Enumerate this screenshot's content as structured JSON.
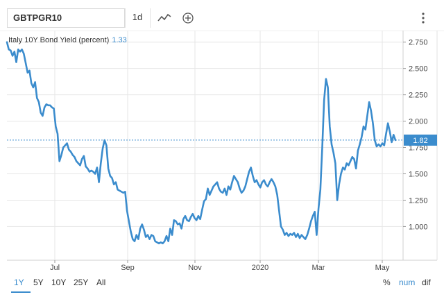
{
  "toolbar": {
    "symbol": "GBTPGR10",
    "interval": "1d",
    "chart_type_icon": "line-chart-icon",
    "compare_icon": "plus-circle-icon",
    "menu_icon": "vertical-dots-icon"
  },
  "series_label": {
    "name": "Italy 10Y Bond Yield (percent)",
    "value": "1.33"
  },
  "colors": {
    "line": "#3b8ccd",
    "accent": "#3b8ccd",
    "price_tag": "#3b8ccd",
    "grid": "#e6e6e6"
  },
  "chart_data": {
    "type": "line",
    "ylim": [
      0.68,
      2.86
    ],
    "y_ticks": [
      1.0,
      1.25,
      1.5,
      1.75,
      2.0,
      2.25,
      2.5,
      2.75
    ],
    "y_tick_labels": [
      "1.000",
      "1.250",
      "1.500",
      "1.750",
      "2.000",
      "2.250",
      "2.500",
      "2.750"
    ],
    "x_tick_labels": [
      "Jul",
      "Sep",
      "Nov",
      "2020",
      "Mar",
      "May"
    ],
    "current_value": 1.82,
    "current_label": "1.82",
    "grid": true,
    "values": [
      2.75,
      2.68,
      2.67,
      2.62,
      2.66,
      2.56,
      2.68,
      2.66,
      2.68,
      2.64,
      2.55,
      2.46,
      2.48,
      2.36,
      2.32,
      2.37,
      2.22,
      2.18,
      2.08,
      2.05,
      2.13,
      2.16,
      2.15,
      2.15,
      2.13,
      2.12,
      1.95,
      1.88,
      1.62,
      1.68,
      1.75,
      1.77,
      1.79,
      1.73,
      1.71,
      1.68,
      1.66,
      1.62,
      1.6,
      1.58,
      1.64,
      1.67,
      1.57,
      1.55,
      1.52,
      1.53,
      1.52,
      1.5,
      1.56,
      1.42,
      1.6,
      1.74,
      1.82,
      1.77,
      1.55,
      1.48,
      1.46,
      1.4,
      1.42,
      1.35,
      1.34,
      1.33,
      1.32,
      1.33,
      1.15,
      1.05,
      0.95,
      0.88,
      0.86,
      0.92,
      0.88,
      0.98,
      1.02,
      0.97,
      0.9,
      0.92,
      0.88,
      0.92,
      0.91,
      0.86,
      0.85,
      0.84,
      0.85,
      0.84,
      0.86,
      0.91,
      0.86,
      0.98,
      0.92,
      1.06,
      1.05,
      1.02,
      1.03,
      0.98,
      1.07,
      1.1,
      1.06,
      1.05,
      1.09,
      1.12,
      1.08,
      1.06,
      1.1,
      1.07,
      1.16,
      1.24,
      1.26,
      1.36,
      1.3,
      1.34,
      1.38,
      1.4,
      1.42,
      1.36,
      1.33,
      1.32,
      1.36,
      1.3,
      1.38,
      1.35,
      1.42,
      1.48,
      1.45,
      1.42,
      1.36,
      1.32,
      1.34,
      1.38,
      1.45,
      1.52,
      1.56,
      1.48,
      1.42,
      1.44,
      1.4,
      1.37,
      1.42,
      1.44,
      1.4,
      1.38,
      1.42,
      1.45,
      1.42,
      1.38,
      1.3,
      1.15,
      1.0,
      0.97,
      0.92,
      0.94,
      0.91,
      0.93,
      0.92,
      0.94,
      0.9,
      0.93,
      0.89,
      0.92,
      0.9,
      0.88,
      0.92,
      0.98,
      1.05,
      1.1,
      1.14,
      0.92,
      1.17,
      1.35,
      1.75,
      2.2,
      2.4,
      2.32,
      1.95,
      1.78,
      1.7,
      1.6,
      1.25,
      1.4,
      1.5,
      1.56,
      1.54,
      1.6,
      1.58,
      1.62,
      1.66,
      1.64,
      1.55,
      1.72,
      1.78,
      1.85,
      1.95,
      1.92,
      2.05,
      2.18,
      2.1,
      1.98,
      1.82,
      1.76,
      1.78,
      1.76,
      1.79,
      1.77,
      1.88,
      1.98,
      1.9,
      1.8,
      1.87,
      1.82
    ]
  },
  "ranges": {
    "items": [
      {
        "label": "1Y",
        "active": true
      },
      {
        "label": "5Y",
        "active": false
      },
      {
        "label": "10Y",
        "active": false
      },
      {
        "label": "25Y",
        "active": false
      },
      {
        "label": "All",
        "active": false
      }
    ]
  },
  "modes": {
    "percent": "%",
    "num": "num",
    "dif": "dif"
  }
}
